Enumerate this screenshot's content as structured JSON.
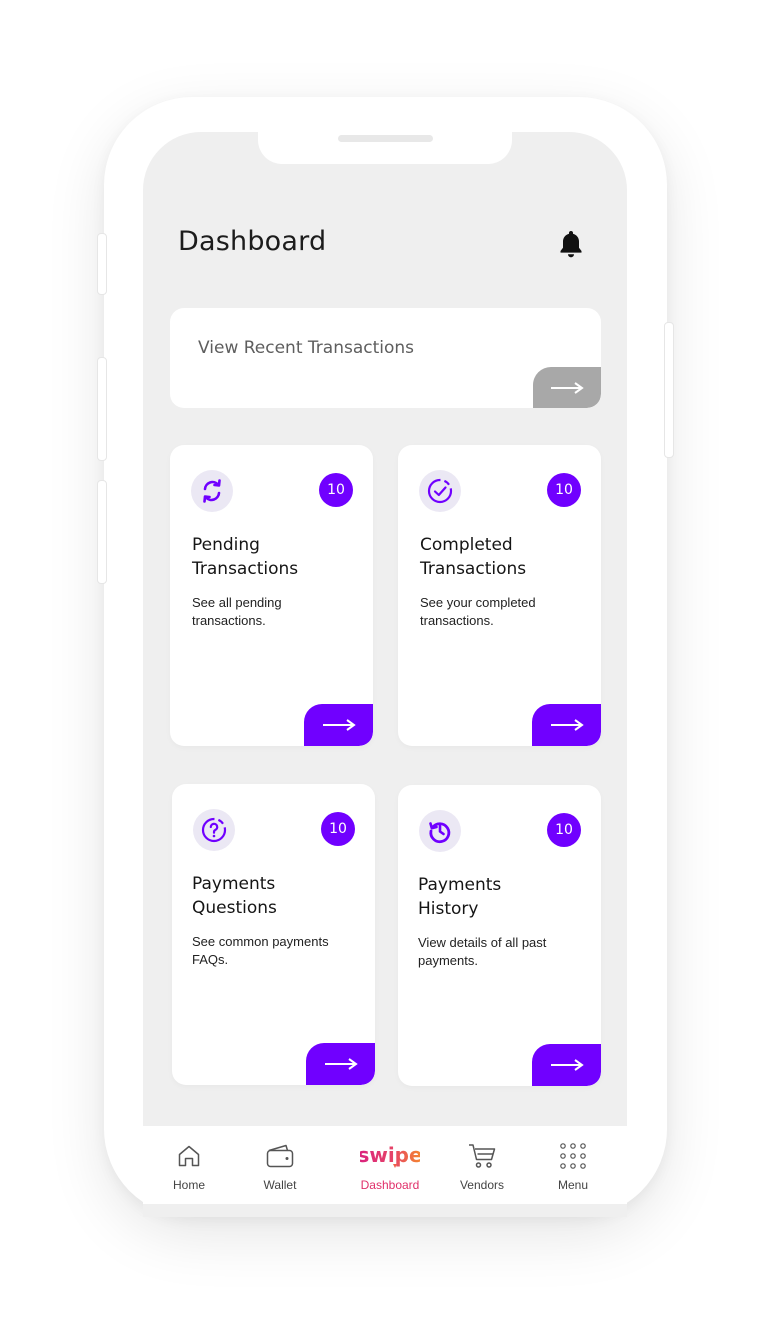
{
  "header": {
    "title": "Dashboard"
  },
  "recent": {
    "label": "View Recent Transactions"
  },
  "cards": [
    {
      "title_line1": "Pending",
      "title_line2": "Transactions",
      "desc_line1": "See all pending",
      "desc_line2": "transactions.",
      "badge": "10",
      "icon": "sync-icon"
    },
    {
      "title_line1": "Completed",
      "title_line2": "Transactions",
      "desc_line1": "See your completed",
      "desc_line2": "transactions.",
      "badge": "10",
      "icon": "check-circle-icon"
    },
    {
      "title_line1": "Payments",
      "title_line2": "Questions",
      "desc_line1": "See common payments",
      "desc_line2": "FAQs.",
      "badge": "10",
      "icon": "question-icon"
    },
    {
      "title_line1": "Payments",
      "title_line2": "History",
      "desc_line1": "View details of all past",
      "desc_line2": "payments.",
      "badge": "10",
      "icon": "history-icon"
    }
  ],
  "nav": {
    "items": [
      {
        "label": "Home",
        "icon": "home-icon"
      },
      {
        "label": "Wallet",
        "icon": "wallet-icon"
      },
      {
        "label": "Dashboard",
        "icon": "swipe-logo",
        "logo_text": "swipe"
      },
      {
        "label": "Vendors",
        "icon": "cart-icon"
      },
      {
        "label": "Menu",
        "icon": "grid-icon"
      }
    ],
    "active": "Dashboard"
  },
  "colors": {
    "accent": "#7000ff",
    "background": "#efefef",
    "active_nav": "#e0306a"
  }
}
